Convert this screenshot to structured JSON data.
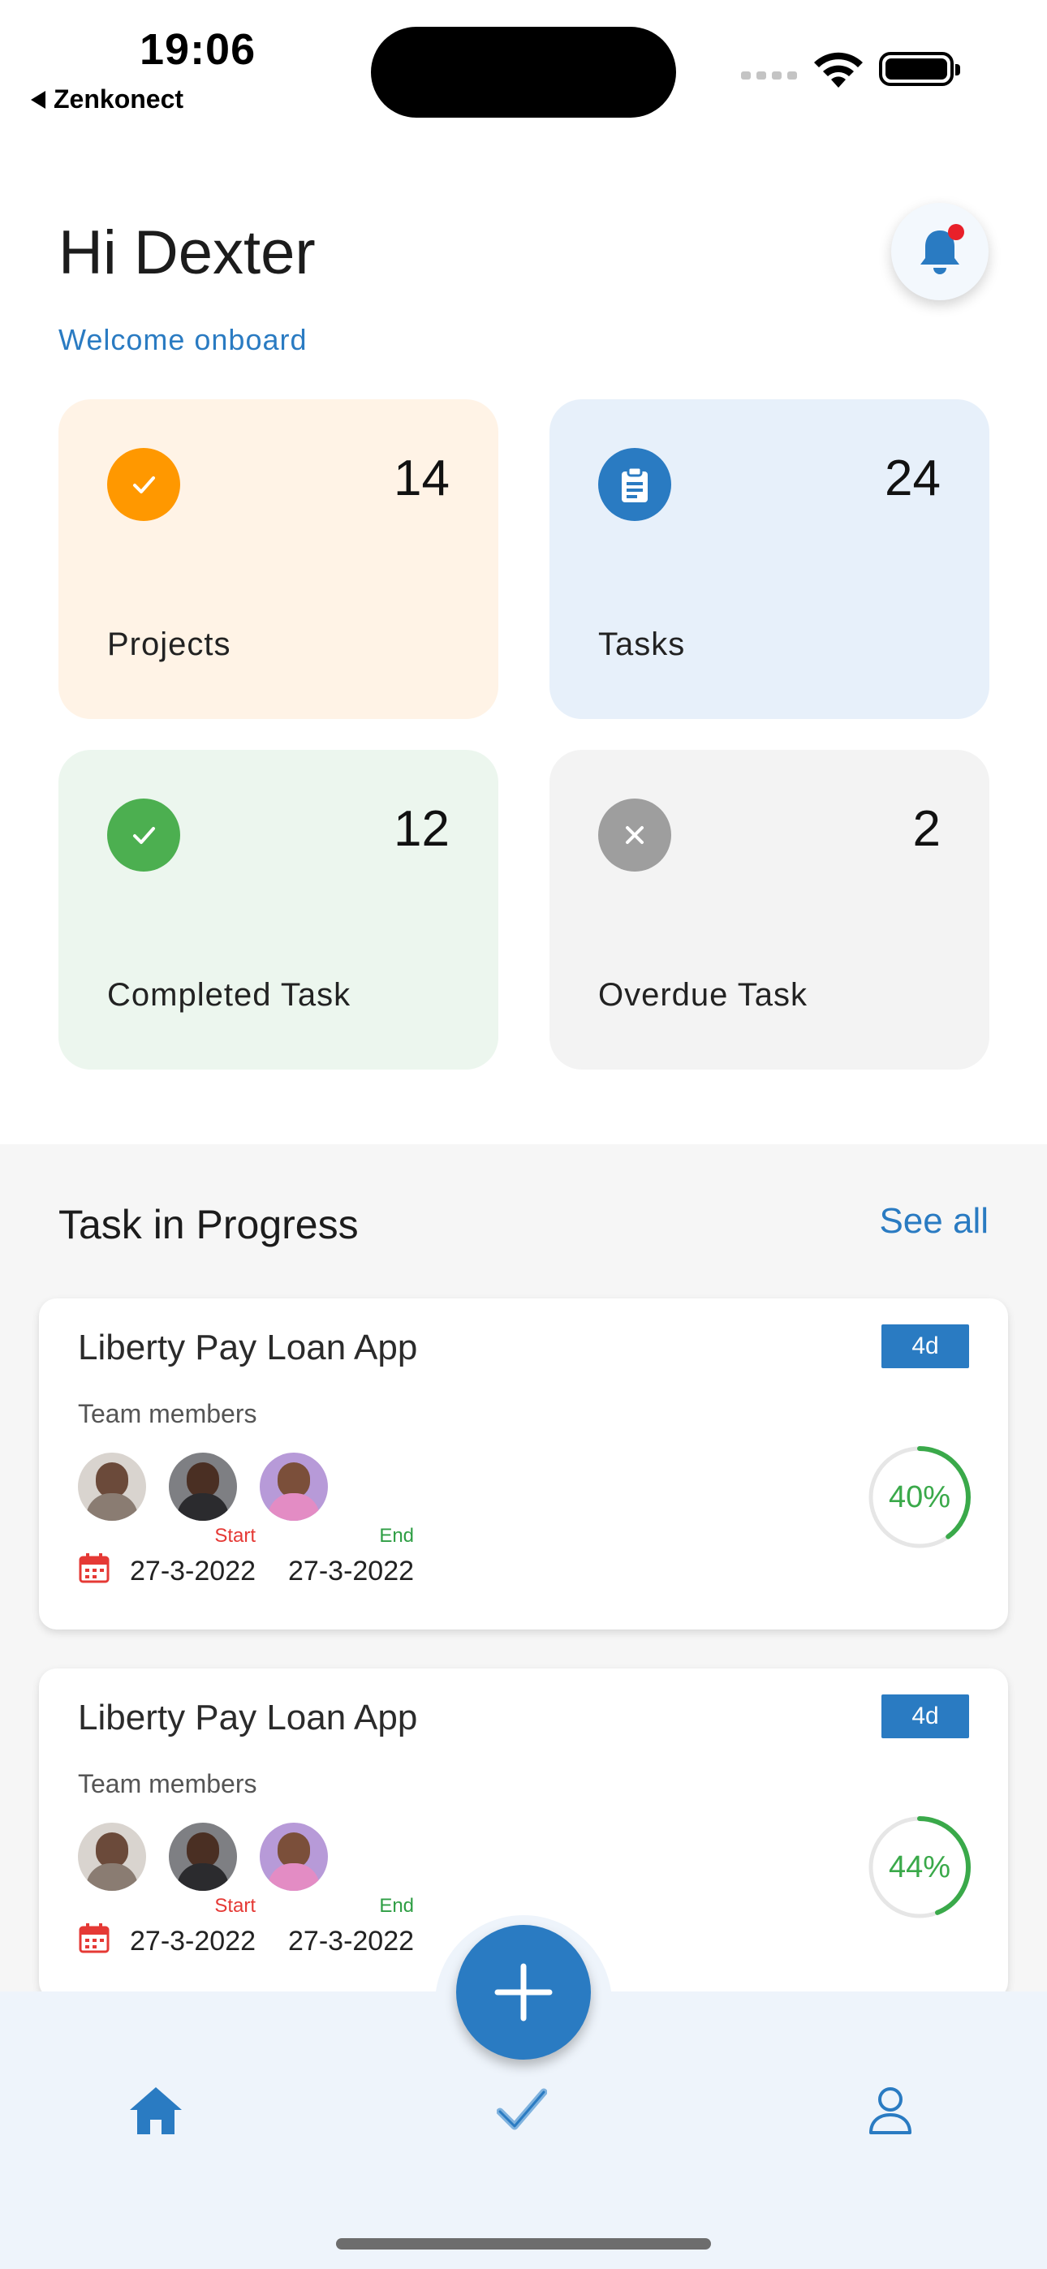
{
  "status_bar": {
    "time": "19:06",
    "back_app": "Zenkonect"
  },
  "header": {
    "greeting": "Hi Dexter",
    "subtitle": "Welcome onboard"
  },
  "stats": {
    "projects": {
      "count": "14",
      "label": "Projects",
      "color": "#ff9800",
      "icon": "check-icon"
    },
    "tasks": {
      "count": "24",
      "label": "Tasks",
      "color": "#2a7bc2",
      "icon": "clipboard-icon"
    },
    "completed": {
      "count": "12",
      "label": "Completed Task",
      "color": "#4caf50",
      "icon": "check-icon"
    },
    "overdue": {
      "count": "2",
      "label": "Overdue Task",
      "color": "#9e9e9e",
      "icon": "close-icon"
    }
  },
  "progress": {
    "title": "Task in Progress",
    "see_all": "See all",
    "tasks": [
      {
        "title": "Liberty Pay Loan App",
        "badge": "4d",
        "team_label": "Team members",
        "start_label": "Start",
        "start_date": "27-3-2022",
        "end_label": "End",
        "end_date": "27-3-2022",
        "percent_text": "40%",
        "percent": 40
      },
      {
        "title": "Liberty Pay Loan App",
        "badge": "4d",
        "team_label": "Team members",
        "start_label": "Start",
        "start_date": "27-3-2022",
        "end_label": "End",
        "end_date": "27-3-2022",
        "percent_text": "44%",
        "percent": 44
      }
    ]
  },
  "colors": {
    "accent": "#2a7bc2",
    "progress": "#3aa94a",
    "notification": "#e8202a"
  },
  "nav": {
    "items": [
      "home-icon",
      "tasks-check-icon",
      "profile-icon"
    ]
  }
}
